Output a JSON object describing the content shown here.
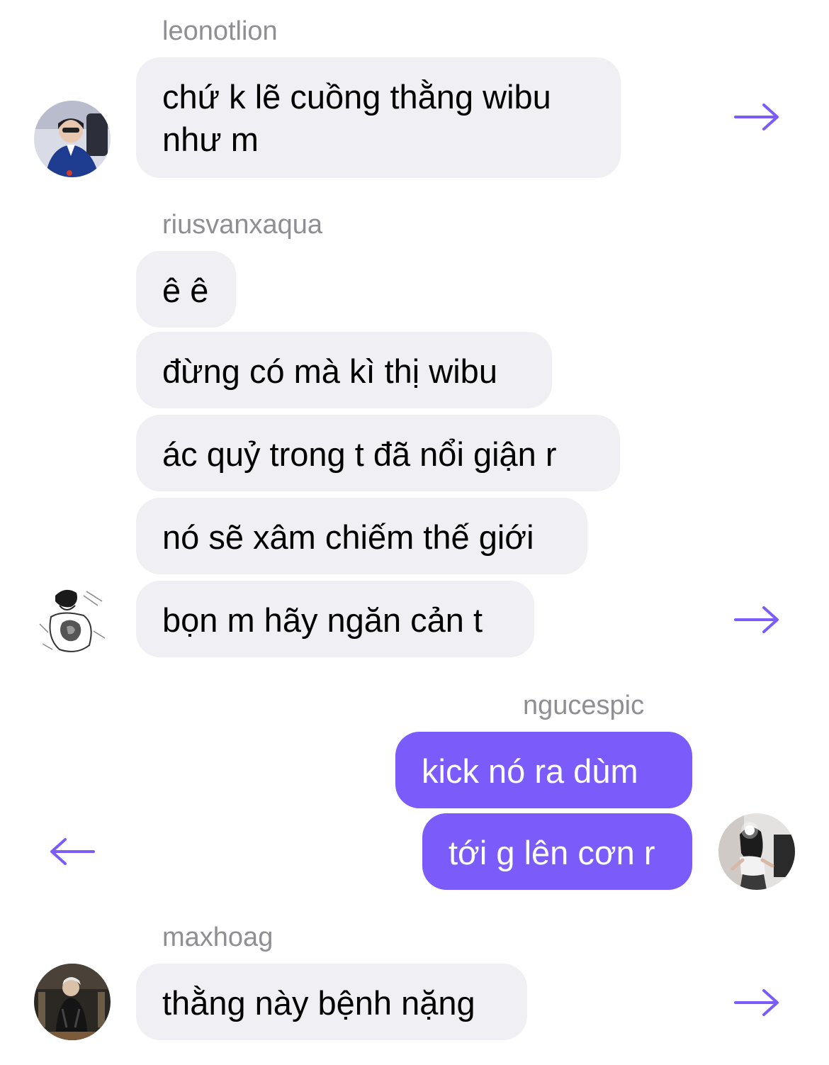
{
  "accent_color": "#7b5cfa",
  "bubble_color": "#efeff4",
  "messages": [
    {
      "sender": "leonotlion",
      "avatar": "avatar-leonotlion",
      "bubbles": [
        "chứ k lẽ cuồng thằng wibu như m"
      ],
      "arrow_icon": "forward-arrow-icon"
    },
    {
      "sender": "riusvanxaqua",
      "avatar": "avatar-riusvanxaqua",
      "bubbles": [
        "ê ê",
        "đừng có mà kì thị wibu",
        "ác quỷ trong t đã nổi giận r",
        "nó sẽ xâm chiếm thế giới",
        "bọn m hãy ngăn cản t"
      ],
      "arrow_icon": "forward-arrow-icon"
    },
    {
      "sender": "ngucespic",
      "avatar": "avatar-ngucespic",
      "bubbles": [
        "kick nó ra dùm",
        "tới g lên cơn r"
      ],
      "arrow_icon": "back-arrow-icon"
    },
    {
      "sender": "maxhoag",
      "avatar": "avatar-maxhoag",
      "bubbles": [
        "thằng này bệnh nặng"
      ],
      "arrow_icon": "forward-arrow-icon"
    }
  ]
}
